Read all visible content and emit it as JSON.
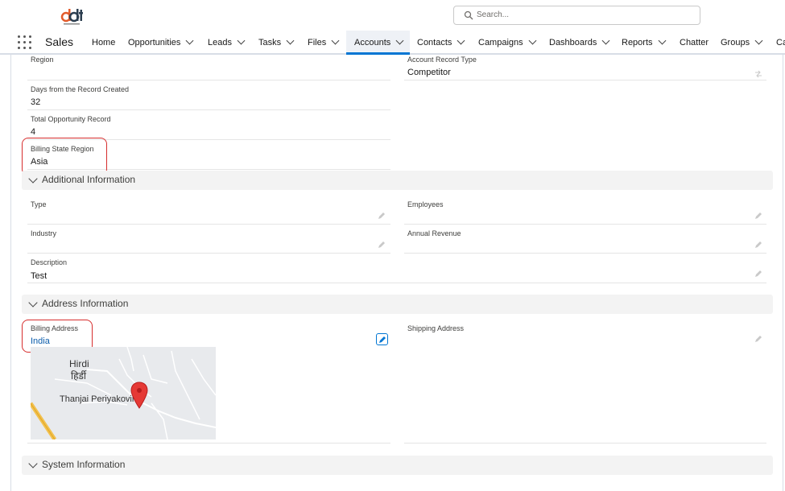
{
  "header": {
    "search_placeholder": "Search..."
  },
  "nav": {
    "app_name": "Sales",
    "items": [
      {
        "label": "Home"
      },
      {
        "label": "Opportunities"
      },
      {
        "label": "Leads"
      },
      {
        "label": "Tasks"
      },
      {
        "label": "Files"
      },
      {
        "label": "Accounts"
      },
      {
        "label": "Contacts"
      },
      {
        "label": "Campaigns"
      },
      {
        "label": "Dashboards"
      },
      {
        "label": "Reports"
      },
      {
        "label": "Chatter"
      },
      {
        "label": "Groups"
      },
      {
        "label": "Ca"
      }
    ],
    "active": "Accounts"
  },
  "fields": {
    "region": {
      "label": "Region",
      "value": ""
    },
    "account_record_type": {
      "label": "Account Record Type",
      "value": "Competitor"
    },
    "days_from_record_created": {
      "label": "Days from the Record Created",
      "value": "32"
    },
    "total_opportunity_record": {
      "label": "Total Opportunity Record",
      "value": "4"
    },
    "billing_state_region": {
      "label": "Billing State Region",
      "value": "Asia"
    }
  },
  "additional_information": {
    "title": "Additional Information",
    "type": {
      "label": "Type",
      "value": ""
    },
    "employees": {
      "label": "Employees",
      "value": ""
    },
    "industry": {
      "label": "Industry",
      "value": ""
    },
    "annual_revenue": {
      "label": "Annual Revenue",
      "value": ""
    },
    "description": {
      "label": "Description",
      "value": "Test"
    }
  },
  "address_information": {
    "title": "Address Information",
    "billing_address": {
      "label": "Billing Address",
      "value": "India"
    },
    "shipping_address": {
      "label": "Shipping Address",
      "value": ""
    },
    "map": {
      "place_1_en": "Hirdi",
      "place_1_hi": "हिर्डी",
      "place_2": "Thanjai Periyakovil"
    }
  },
  "system_information": {
    "title": "System Information"
  },
  "colors": {
    "accent": "#0176d3",
    "highlight": "#d62d2d",
    "link": "#0b5cab",
    "pin": "#e53935"
  }
}
